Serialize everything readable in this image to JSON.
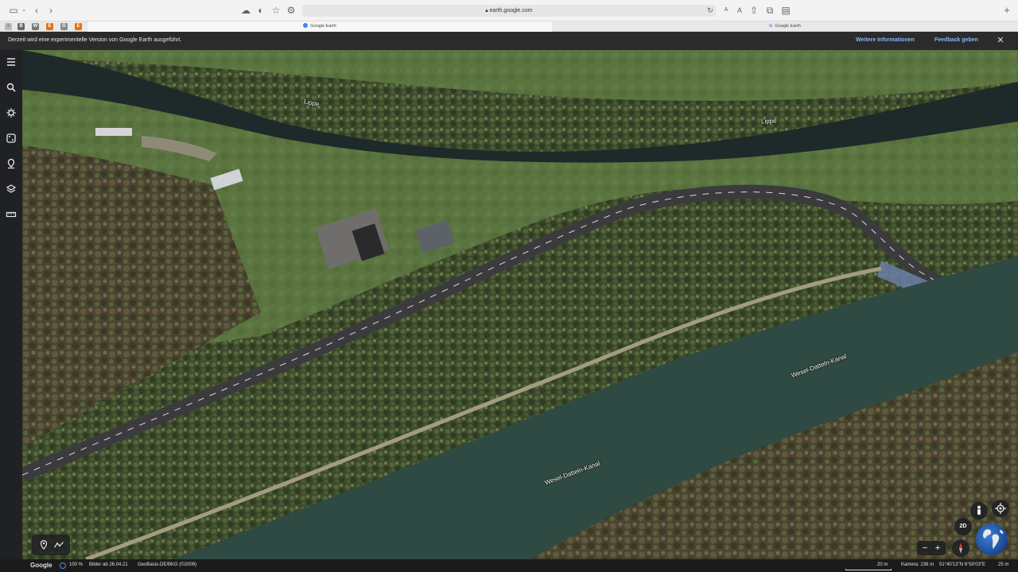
{
  "browser": {
    "url": "earth.google.com",
    "tabs": [
      {
        "title": "Google Earth",
        "active": true
      },
      {
        "title": "Google Earth",
        "active": false
      }
    ],
    "bookmarks": [
      "B",
      "W",
      "E",
      "G",
      "E"
    ],
    "bookmark_colors": [
      "#666666",
      "#777777",
      "#e8710a",
      "#888888",
      "#e8710a"
    ]
  },
  "notice": {
    "text": "Derzeit wird eine experimentelle Version von Google Earth ausgeführt.",
    "more_link": "Weitere Informationen",
    "feedback_link": "Feedback geben"
  },
  "sidebar": {
    "icons": [
      "menu-icon",
      "search-icon",
      "voyager-icon",
      "feeling-lucky-icon",
      "projects-icon",
      "map-style-icon",
      "measure-icon"
    ]
  },
  "map": {
    "labels": {
      "river_lippe_1": "Lippe",
      "river_lippe_2": "Lippe",
      "canal_1": "Wesel-Datteln-Kanal",
      "canal_2": "Wesel-Datteln-Kanal"
    },
    "controls": {
      "view_mode": "2D"
    }
  },
  "status": {
    "brand": "Google",
    "loading": "100 %",
    "imagery_date": "Bilder ab 26.04.21",
    "attribution": "GeoBasis-DE/BKG (©2009)",
    "scale": "20 m",
    "camera": "Kamera: 236 m",
    "coordinates": "51°40'13\"N 6°50'03\"E",
    "elevation": "25 m"
  },
  "colors": {
    "accent_link": "#8ab4f8",
    "rail_bg": "#202124",
    "water": "#2f4a43"
  }
}
